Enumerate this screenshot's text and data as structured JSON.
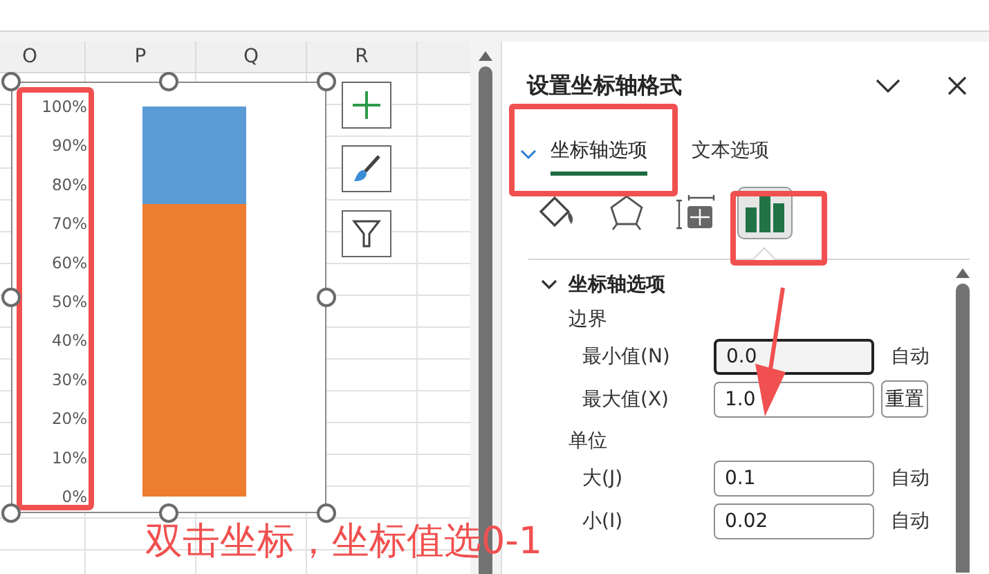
{
  "sheet": {
    "columns": [
      "O",
      "P",
      "Q",
      "R"
    ]
  },
  "chart": {
    "chart_data": {
      "type": "bar",
      "stacked": true,
      "ylim": [
        0,
        1
      ],
      "yticks": [
        {
          "value": 0,
          "label": "0%"
        },
        {
          "value": 0.1,
          "label": "10%"
        },
        {
          "value": 0.2,
          "label": "20%"
        },
        {
          "value": 0.3,
          "label": "30%"
        },
        {
          "value": 0.4,
          "label": "40%"
        },
        {
          "value": 0.5,
          "label": "50%"
        },
        {
          "value": 0.6,
          "label": "60%"
        },
        {
          "value": 0.7,
          "label": "70%"
        },
        {
          "value": 0.8,
          "label": "80%"
        },
        {
          "value": 0.9,
          "label": "90%"
        },
        {
          "value": 1,
          "label": "100%"
        }
      ],
      "series": [
        {
          "color": "#ed7d31",
          "values": [
            0.75
          ]
        },
        {
          "color": "#5b9bd5",
          "values": [
            0.25
          ]
        }
      ]
    }
  },
  "pane": {
    "title": "设置坐标轴格式",
    "tabs": [
      {
        "label": "坐标轴选项",
        "selected": true
      },
      {
        "label": "文本选项",
        "selected": false
      }
    ],
    "icon_tabs": [
      {
        "kind": "fill",
        "selected": false
      },
      {
        "kind": "effects",
        "selected": false
      },
      {
        "kind": "size",
        "selected": false
      },
      {
        "kind": "axis",
        "selected": true
      }
    ],
    "section": {
      "title": "坐标轴选项",
      "expanded": true,
      "groups": [
        {
          "heading": "边界",
          "fields": [
            {
              "label": "最小值(N)",
              "value": "0.0",
              "action": "自动",
              "kind": "auto",
              "focused": true
            },
            {
              "label": "最大值(X)",
              "value": "1.0",
              "action": "重置",
              "kind": "reset",
              "focused": false
            }
          ]
        },
        {
          "heading": "单位",
          "fields": [
            {
              "label": "大(J)",
              "value": "0.1",
              "action": "自动",
              "kind": "auto",
              "focused": false
            },
            {
              "label": "小(I)",
              "value": "0.02",
              "action": "自动",
              "kind": "auto",
              "focused": false
            }
          ]
        }
      ]
    }
  },
  "annotation": {
    "text": "双击坐标，坐标值选0-1"
  }
}
